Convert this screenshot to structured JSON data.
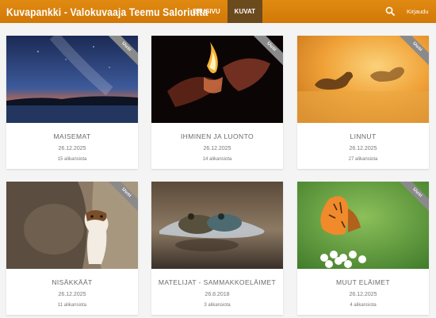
{
  "header": {
    "brand": "Kuvapankki - Valokuvaaja Teemu Saloriutta",
    "nav": [
      {
        "label": "ETUSIVU",
        "active": false
      },
      {
        "label": "KUVAT",
        "active": true
      }
    ],
    "search_icon": "search-icon",
    "login_label": "Kirjaudu",
    "accent_color": "#d98107"
  },
  "cards": [
    {
      "title": "MAISEMAT",
      "date": "26.12.2025",
      "count": "15 alikansiota",
      "badge": "Uusi"
    },
    {
      "title": "IHMINEN JA LUONTO",
      "date": "26.12.2025",
      "count": "14 alikansiota",
      "badge": "Uusi"
    },
    {
      "title": "LINNUT",
      "date": "26.12.2025",
      "count": "27 alikansiota",
      "badge": "Uusi"
    },
    {
      "title": "NISÄKKÄÄT",
      "date": "26.12.2025",
      "count": "11 alikansiota",
      "badge": "Uusi"
    },
    {
      "title": "MATELIJAT - SAMMAKKOELÄIMET",
      "date": "26.8.2018",
      "count": "3 alikansiota",
      "badge": ""
    },
    {
      "title": "MUUT ELÄIMET",
      "date": "26.12.2025",
      "count": "4 alikansiota",
      "badge": "Uusi"
    }
  ]
}
